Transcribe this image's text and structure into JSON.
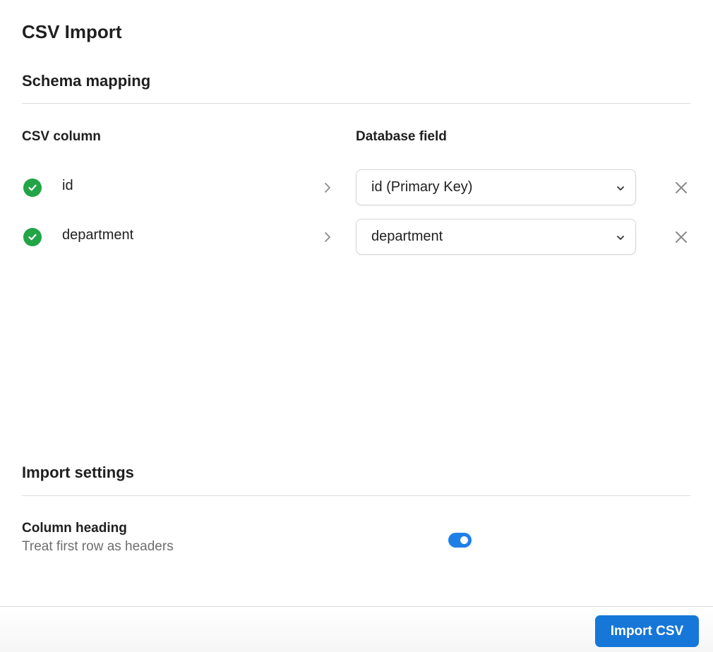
{
  "title": "CSV Import",
  "schema_section": {
    "title": "Schema mapping",
    "csv_column_header": "CSV column",
    "database_field_header": "Database field",
    "rows": [
      {
        "csv_column": "id",
        "database_field": "id (Primary Key)",
        "status": "check-icon"
      },
      {
        "csv_column": "department",
        "database_field": "department",
        "status": "check-icon"
      }
    ]
  },
  "settings_section": {
    "title": "Import settings",
    "column_heading": {
      "label": "Column heading",
      "description": "Treat first row as headers",
      "enabled": true
    }
  },
  "footer": {
    "import_label": "Import CSV"
  },
  "colors": {
    "accent": "#1677d9",
    "success": "#22a447",
    "toggle_on": "#1e7fe6"
  }
}
